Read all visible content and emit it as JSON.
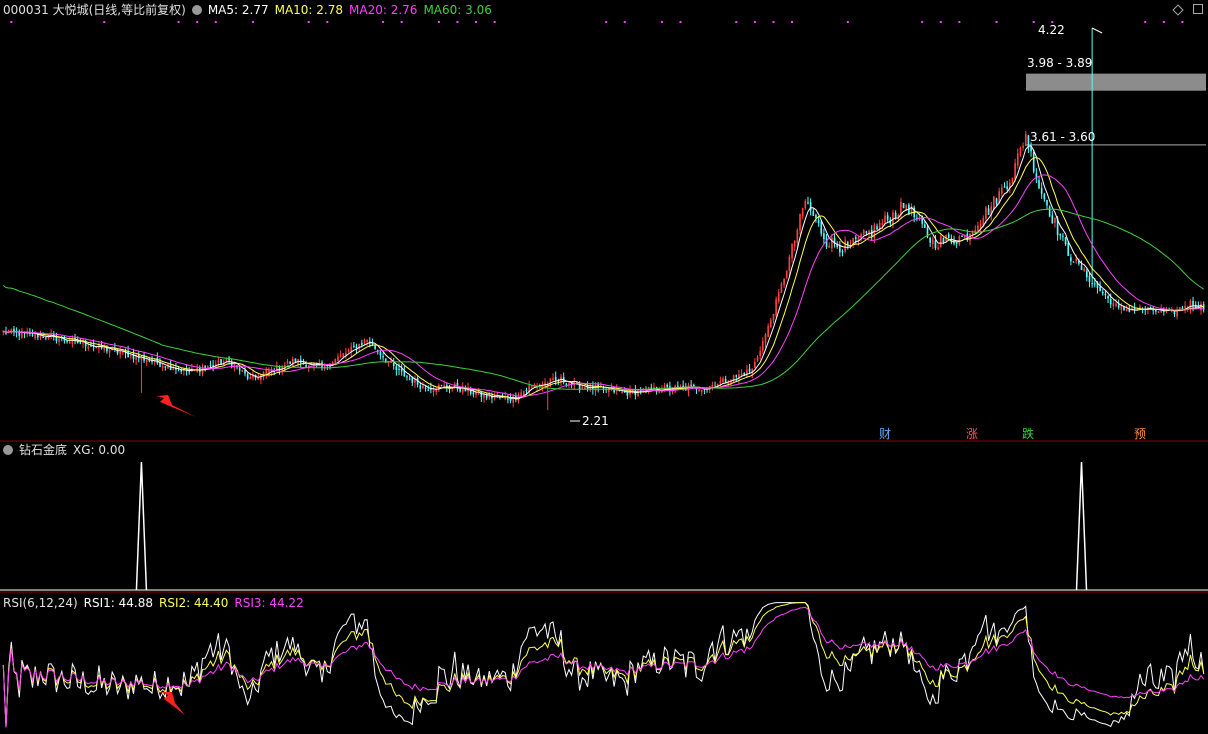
{
  "header": {
    "title": "000031 大悦城(日线,等比前复权)",
    "ma5": "MA5: 2.77",
    "ma10": "MA10: 2.78",
    "ma20": "MA20: 2.76",
    "ma60": "MA60: 3.06"
  },
  "xg_panel": {
    "title": "钻石金底",
    "value": "XG: 0.00"
  },
  "rsi_panel": {
    "title": "RSI(6,12,24)",
    "rsi1": "RSI1: 44.88",
    "rsi2": "RSI2: 44.40",
    "rsi3": "RSI3: 44.22"
  },
  "markers": {
    "cai": "财",
    "zhang": "涨",
    "die": "跌",
    "yu": "预"
  },
  "colors": {
    "up": "#ff4040",
    "down": "#54ffff",
    "ma5": "#ffffff",
    "ma10": "#ffff54",
    "ma20": "#ff40ff",
    "ma60": "#3cd23c",
    "panel_border": "#8b0000",
    "rsi1": "#ffffff",
    "rsi2": "#ffff54",
    "rsi3": "#ff40ff",
    "annot_arrow": "#ff2020"
  },
  "chart_data": [
    {
      "type": "candlestick",
      "title": "000031 大悦城(日线,等比前复权)",
      "price_range": [
        2.21,
        4.22
      ],
      "annotations": [
        "4.22",
        "3.98 - 3.89",
        "3.61 - 3.60",
        "2.21"
      ],
      "anchors": [
        [
          0,
          2.62
        ],
        [
          15,
          2.6
        ],
        [
          30,
          2.56
        ],
        [
          50,
          2.49
        ],
        [
          70,
          2.41
        ],
        [
          85,
          2.47
        ],
        [
          93,
          2.37
        ],
        [
          110,
          2.47
        ],
        [
          120,
          2.43
        ],
        [
          137,
          2.58
        ],
        [
          148,
          2.42
        ],
        [
          158,
          2.33
        ],
        [
          170,
          2.33
        ],
        [
          182,
          2.28
        ],
        [
          192,
          2.27
        ],
        [
          198,
          2.33
        ],
        [
          210,
          2.37
        ],
        [
          215,
          2.34
        ],
        [
          235,
          2.3
        ],
        [
          248,
          2.32
        ],
        [
          265,
          2.33
        ],
        [
          275,
          2.38
        ],
        [
          282,
          2.42
        ],
        [
          288,
          2.64
        ],
        [
          295,
          2.95
        ],
        [
          302,
          3.31
        ],
        [
          310,
          3.1
        ],
        [
          318,
          3.06
        ],
        [
          330,
          3.18
        ],
        [
          340,
          3.29
        ],
        [
          350,
          3.09
        ],
        [
          362,
          3.12
        ],
        [
          372,
          3.28
        ],
        [
          380,
          3.45
        ],
        [
          385,
          3.66
        ],
        [
          390,
          3.39
        ],
        [
          400,
          3.06
        ],
        [
          410,
          2.88
        ],
        [
          420,
          2.74
        ],
        [
          430,
          2.74
        ],
        [
          440,
          2.72
        ],
        [
          447,
          2.77
        ],
        [
          452,
          2.75
        ]
      ],
      "ma_labels": [
        "MA5",
        "MA10",
        "MA20",
        "MA60"
      ]
    },
    {
      "type": "line",
      "title": "钻石金底",
      "series": [
        {
          "name": "XG",
          "last": 0.0,
          "signal_days": [
            52,
            406
          ]
        }
      ]
    },
    {
      "type": "line",
      "title": "RSI(6,12,24)",
      "series": [
        {
          "name": "RSI1",
          "last": 44.88
        },
        {
          "name": "RSI2",
          "last": 44.4
        },
        {
          "name": "RSI3",
          "last": 44.22
        }
      ]
    }
  ]
}
